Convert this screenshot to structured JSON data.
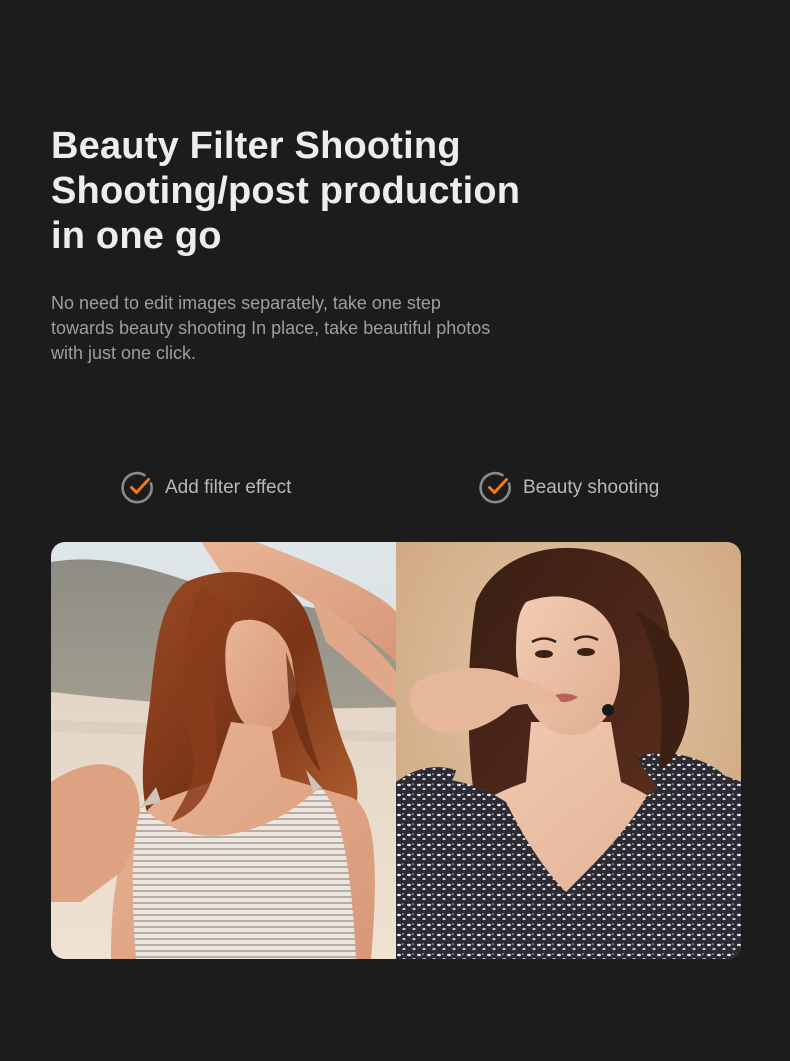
{
  "headline": {
    "line1": "Beauty Filter Shooting",
    "line2": "Shooting/post production",
    "line3": "in one go"
  },
  "description": {
    "line1": "No need to edit images separately, take one step",
    "line2": "towards beauty shooting In place, take beautiful photos",
    "line3": "with just one click."
  },
  "features": [
    {
      "label": "Add filter effect",
      "icon": "check-circle-icon"
    },
    {
      "label": "Beauty shooting",
      "icon": "check-circle-icon"
    }
  ],
  "colors": {
    "background": "#1c1c1d",
    "accent": "#f07a1c",
    "heading": "#ededed",
    "body_text": "#9e9e9e"
  }
}
